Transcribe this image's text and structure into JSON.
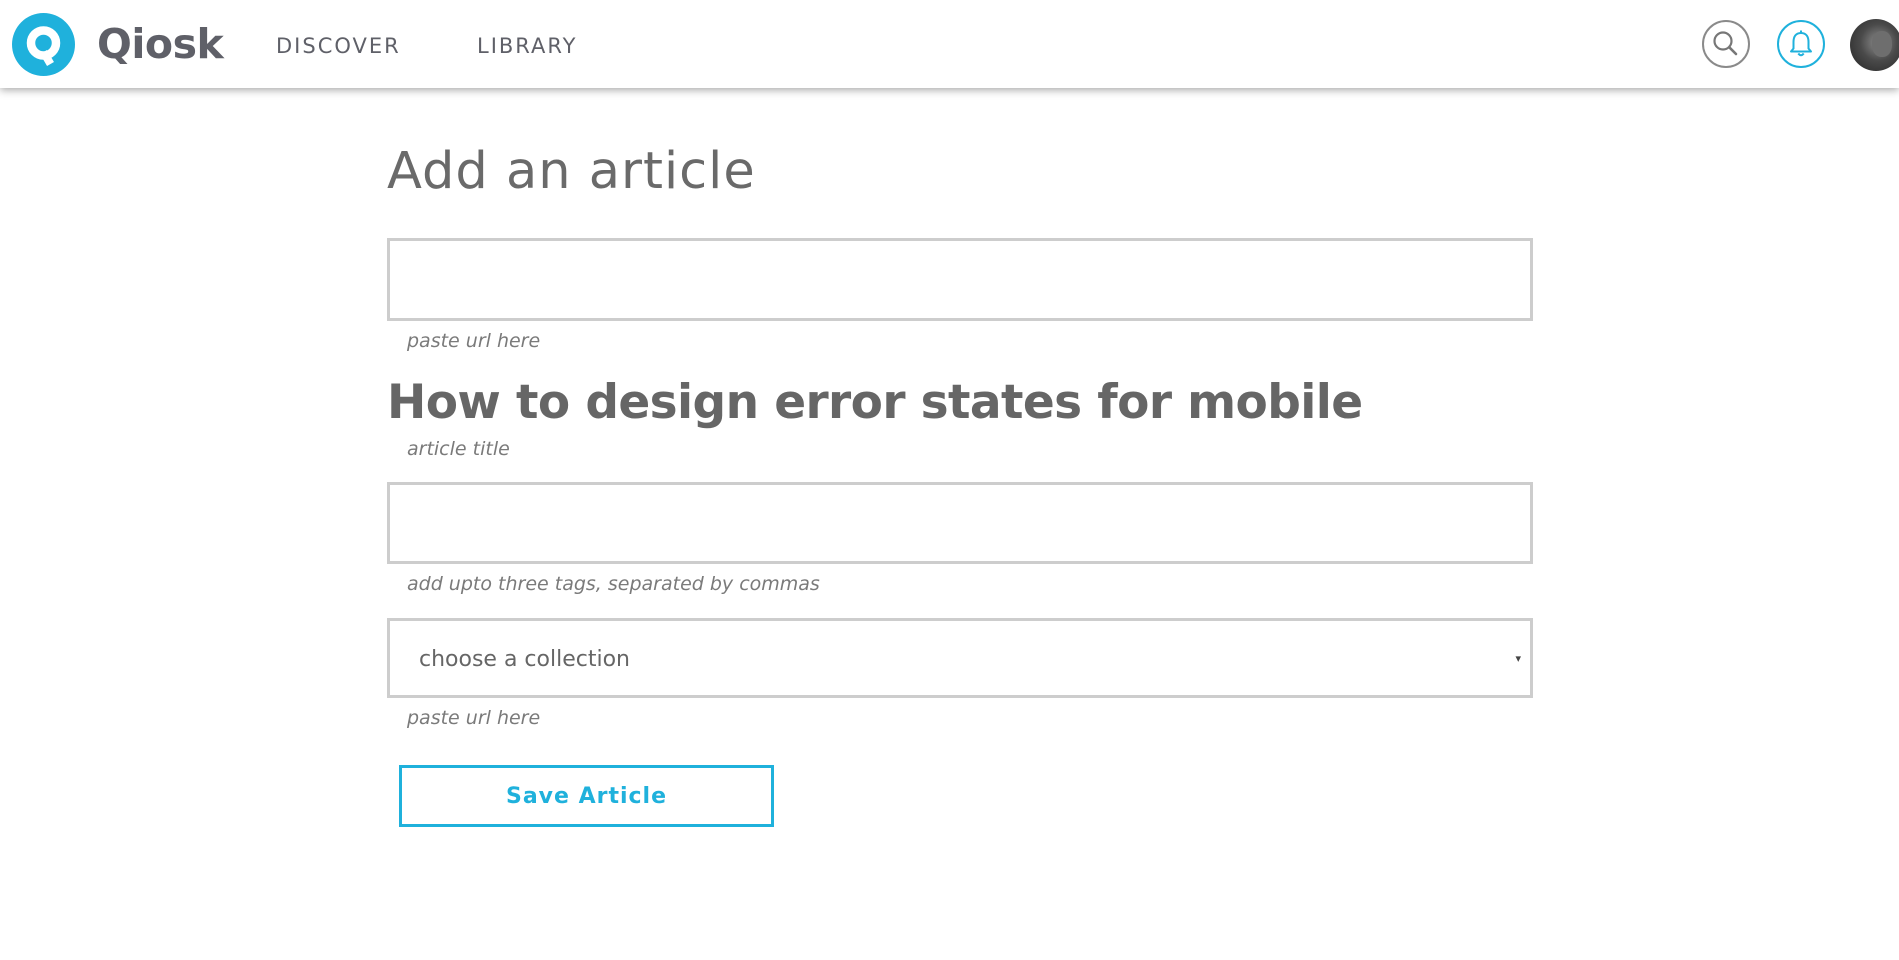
{
  "app": {
    "name": "Qiosk",
    "logo_letter": "Q",
    "brand_color": "#1fb1dc"
  },
  "nav": {
    "items": [
      {
        "label": "DISCOVER"
      },
      {
        "label": "LIBRARY"
      }
    ]
  },
  "header_icons": {
    "search": "search-icon",
    "notifications": "bell-icon",
    "avatar": "user-avatar"
  },
  "form": {
    "heading": "Add an article",
    "url": {
      "value": "",
      "helper": "paste url here"
    },
    "article_title": {
      "value": "How to design error states for mobile",
      "helper": "article title"
    },
    "tags": {
      "value": "",
      "helper": "add upto three tags, separated by commas"
    },
    "collection": {
      "selected": "choose a collection",
      "caret": "▾",
      "helper": "paste url here"
    },
    "save_label": "Save Article"
  }
}
